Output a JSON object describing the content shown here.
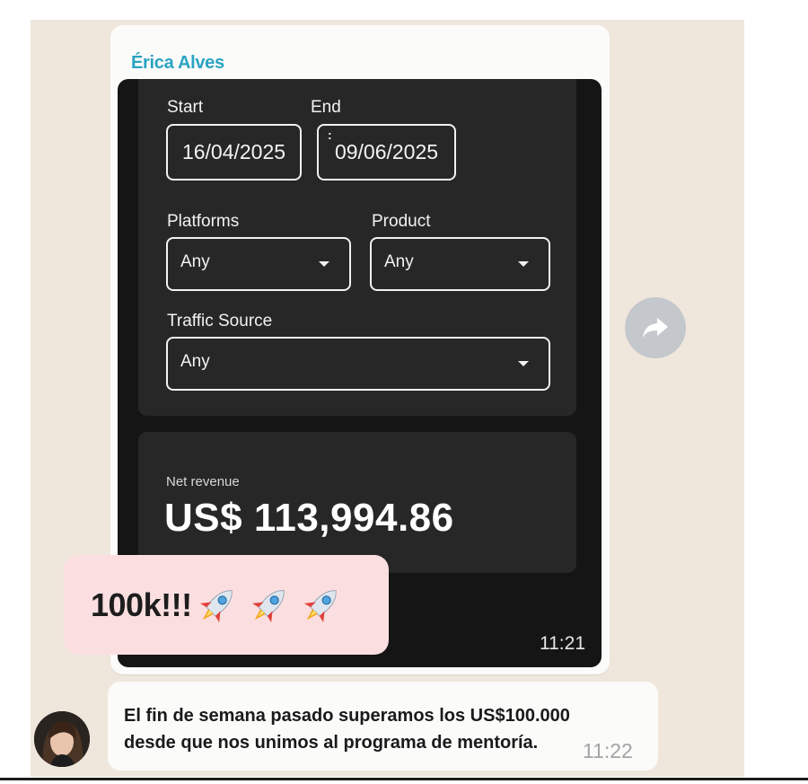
{
  "chat": {
    "message1": {
      "sender": "Érica Alves",
      "screenshot": {
        "start_label": "Start",
        "start_value": "16/04/2025",
        "end_label": "End",
        "end_value": "09/06/2025",
        "date_separator": ":",
        "platforms_label": "Platforms",
        "platforms_value": "Any",
        "product_label": "Product",
        "product_value": "Any",
        "traffic_label": "Traffic Source",
        "traffic_value": "Any",
        "net_revenue_label": "Net revenue",
        "net_revenue_value": "US$ 113,994.86"
      },
      "time": "11:21"
    },
    "sticker": {
      "text": "100k!!!",
      "emoji": "rocket-emoji",
      "emoji_count": 3
    },
    "message2": {
      "text": "El fin de semana pasado superamos los US$100.000 desde que nos unimos al programa de mentoría.",
      "time": "11:22"
    },
    "forward_icon": "forward-arrow-icon"
  },
  "colors": {
    "sender": "#2aa3c2",
    "chat_background": "#efe7dc",
    "bubble": "#fbfbfa",
    "screenshot_bg": "#151515",
    "card_bg": "#272727",
    "sticker_bg": "#fbdfe0"
  }
}
